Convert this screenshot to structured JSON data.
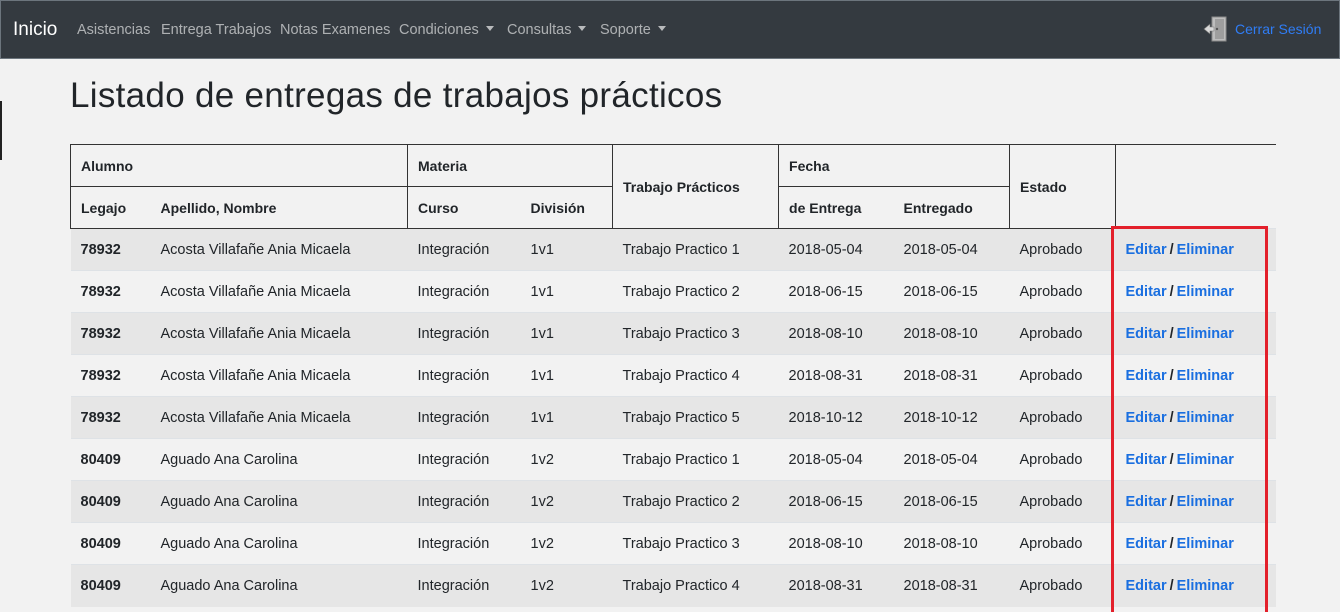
{
  "navbar": {
    "brand": "Inicio",
    "items": [
      {
        "label": "Asistencias",
        "dropdown": false
      },
      {
        "label": "Entrega Trabajos",
        "dropdown": false
      },
      {
        "label": "Notas Examenes",
        "dropdown": false
      },
      {
        "label": "Condiciones",
        "dropdown": true
      },
      {
        "label": "Consultas",
        "dropdown": true
      },
      {
        "label": "Soporte",
        "dropdown": true
      }
    ],
    "logout_label": "Cerrar Sesión",
    "logout_icon": "door-exit-icon"
  },
  "page": {
    "title": "Listado de entregas de trabajos prácticos"
  },
  "table": {
    "group_headers": {
      "alumno": "Alumno",
      "materia": "Materia",
      "trabajo": "Trabajo Prácticos",
      "fecha": "Fecha",
      "estado": "Estado"
    },
    "sub_headers": {
      "legajo": "Legajo",
      "nombre": "Apellido, Nombre",
      "curso": "Curso",
      "division": "División",
      "de_entrega": "de Entrega",
      "entregado": "Entregado"
    },
    "edit_label": "Editar",
    "separator": "/",
    "delete_label": "Eliminar",
    "rows": [
      {
        "legajo": "78932",
        "nombre": "Acosta Villafañe Ania Micaela",
        "curso": "Integración",
        "division": "1v1",
        "trabajo": "Trabajo Practico 1",
        "de_entrega": "2018-05-04",
        "entregado": "2018-05-04",
        "estado": "Aprobado"
      },
      {
        "legajo": "78932",
        "nombre": "Acosta Villafañe Ania Micaela",
        "curso": "Integración",
        "division": "1v1",
        "trabajo": "Trabajo Practico 2",
        "de_entrega": "2018-06-15",
        "entregado": "2018-06-15",
        "estado": "Aprobado"
      },
      {
        "legajo": "78932",
        "nombre": "Acosta Villafañe Ania Micaela",
        "curso": "Integración",
        "division": "1v1",
        "trabajo": "Trabajo Practico 3",
        "de_entrega": "2018-08-10",
        "entregado": "2018-08-10",
        "estado": "Aprobado"
      },
      {
        "legajo": "78932",
        "nombre": "Acosta Villafañe Ania Micaela",
        "curso": "Integración",
        "division": "1v1",
        "trabajo": "Trabajo Practico 4",
        "de_entrega": "2018-08-31",
        "entregado": "2018-08-31",
        "estado": "Aprobado"
      },
      {
        "legajo": "78932",
        "nombre": "Acosta Villafañe Ania Micaela",
        "curso": "Integración",
        "division": "1v1",
        "trabajo": "Trabajo Practico 5",
        "de_entrega": "2018-10-12",
        "entregado": "2018-10-12",
        "estado": "Aprobado"
      },
      {
        "legajo": "80409",
        "nombre": "Aguado Ana Carolina",
        "curso": "Integración",
        "division": "1v2",
        "trabajo": "Trabajo Practico 1",
        "de_entrega": "2018-05-04",
        "entregado": "2018-05-04",
        "estado": "Aprobado"
      },
      {
        "legajo": "80409",
        "nombre": "Aguado Ana Carolina",
        "curso": "Integración",
        "division": "1v2",
        "trabajo": "Trabajo Practico 2",
        "de_entrega": "2018-06-15",
        "entregado": "2018-06-15",
        "estado": "Aprobado"
      },
      {
        "legajo": "80409",
        "nombre": "Aguado Ana Carolina",
        "curso": "Integración",
        "division": "1v2",
        "trabajo": "Trabajo Practico 3",
        "de_entrega": "2018-08-10",
        "entregado": "2018-08-10",
        "estado": "Aprobado"
      },
      {
        "legajo": "80409",
        "nombre": "Aguado Ana Carolina",
        "curso": "Integración",
        "division": "1v2",
        "trabajo": "Trabajo Practico 4",
        "de_entrega": "2018-08-31",
        "entregado": "2018-08-31",
        "estado": "Aprobado"
      }
    ]
  },
  "colors": {
    "navbar_bg": "#343a40",
    "link": "#1a6fe0",
    "highlight": "#e3202b",
    "row_stripe": "#e6e6e6"
  }
}
